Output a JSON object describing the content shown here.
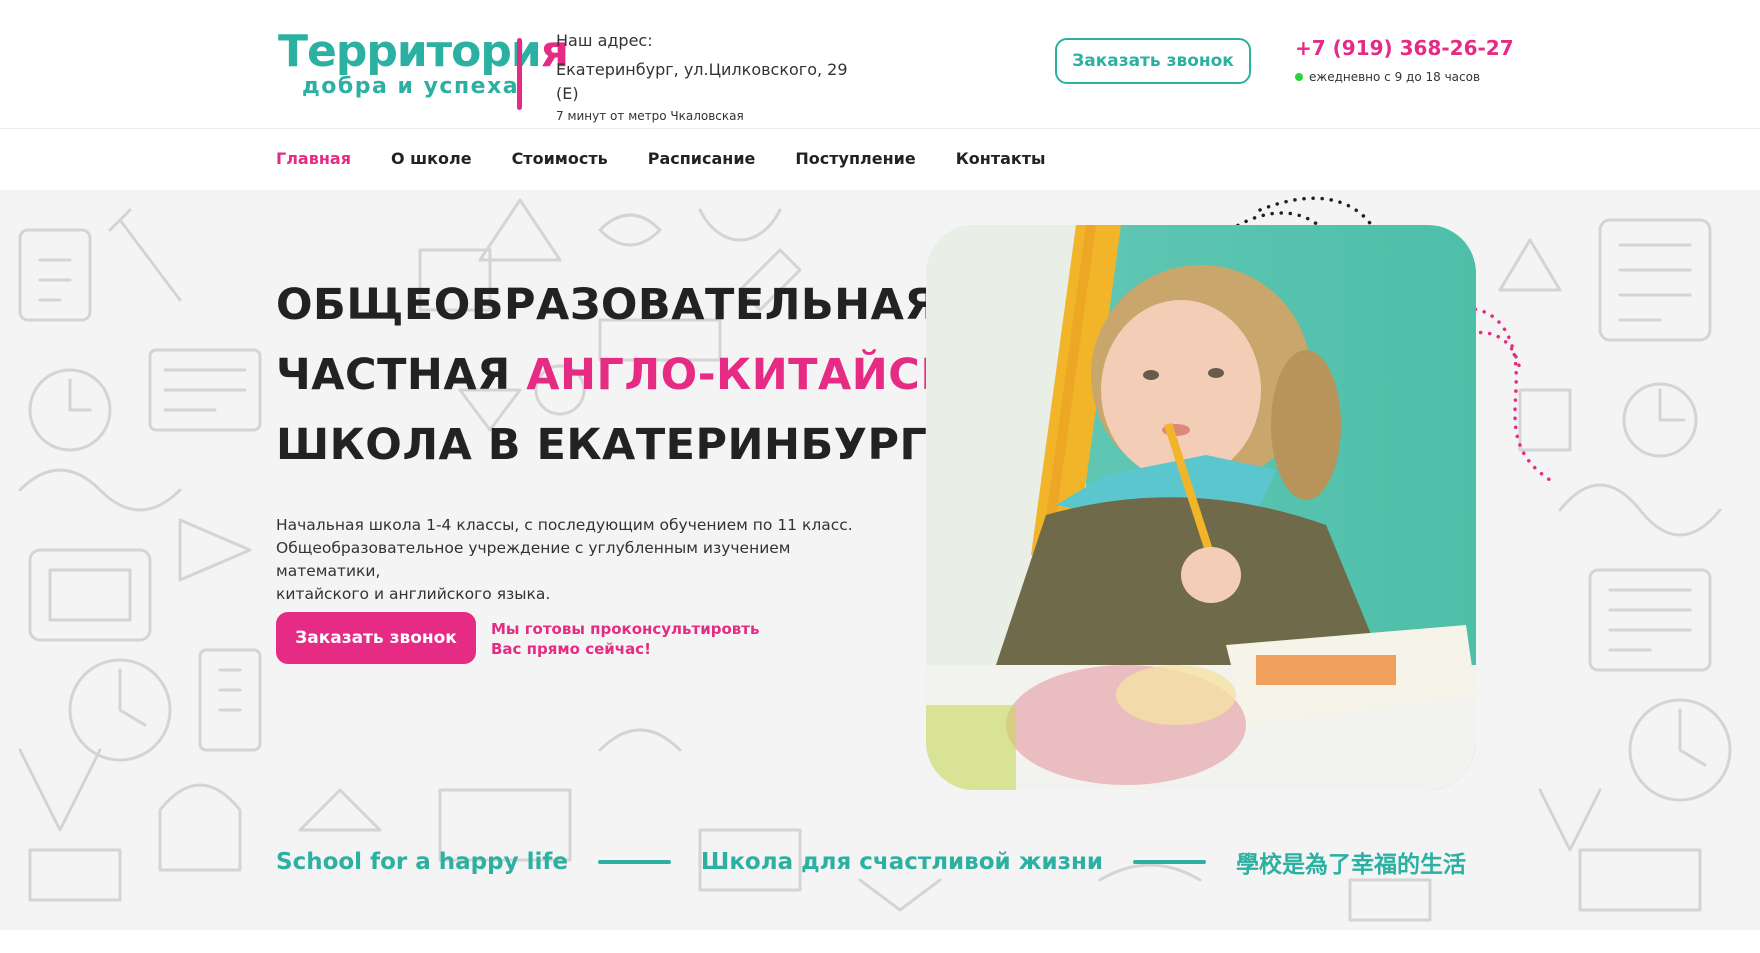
{
  "header": {
    "logo": {
      "title_main": "Территори",
      "title_accent": "я",
      "subtitle": "добра и успеха"
    },
    "address": {
      "label": "Наш адрес:",
      "street": "Екатеринбург, ул.Цилковского, 29 (Е)",
      "metro": "7 минут от метро Чкаловская"
    },
    "callback_button": "Заказать звонок",
    "phone": "+7 (919) 368-26-27",
    "hours": "ежедневно с 9 до 18 часов"
  },
  "nav": {
    "items": [
      {
        "label": "Главная",
        "active": true
      },
      {
        "label": "О школе"
      },
      {
        "label": "Стоимость"
      },
      {
        "label": "Расписание"
      },
      {
        "label": "Поступление"
      },
      {
        "label": "Контакты"
      }
    ]
  },
  "hero": {
    "headline_line1": "ОБЩЕОБРАЗОВАТЕЛЬНАЯ",
    "headline_line2_dark": "ЧАСТНАЯ ",
    "headline_line2_pink": "АНГЛО-КИТАЙСКАЯ",
    "headline_line3": "ШКОЛА В ЕКАТЕРИНБУРГЕ",
    "description": [
      "Начальная школа 1-4 классы, с последующим обучением по 11 класс.",
      "Общеобразовательное учреждение с углубленным изучением математики,",
      "китайского и английского языка."
    ],
    "cta_button": "Заказать звонок",
    "consult_line1": "Мы готовы проконсультировть",
    "consult_line2": "Вас прямо сейчас!"
  },
  "slogans": [
    "School for a happy life",
    "Школа для счастливой жизни",
    "學校是為了幸福的生活"
  ],
  "colors": {
    "brand_teal": "#2bb0a2",
    "brand_pink": "#e52b84",
    "status_green": "#27d63a"
  }
}
